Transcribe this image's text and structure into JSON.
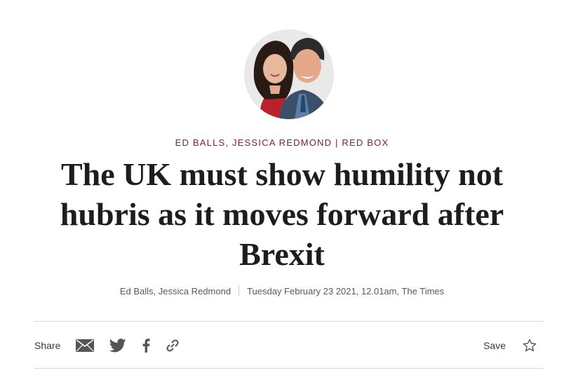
{
  "article": {
    "kicker": "ED BALLS, JESSICA REDMOND | RED BOX",
    "headline": "The UK must show humility not hubris as it moves forward after Brexit",
    "byline": {
      "authors": "Ed Balls, Jessica Redmond",
      "published": "Tuesday February 23 2021, 12.01am, The Times"
    }
  },
  "share_bar": {
    "share_label": "Share",
    "icons": [
      "email-icon",
      "twitter-icon",
      "facebook-icon",
      "link-icon"
    ],
    "save_label": "Save",
    "save_icon": "star-outline-icon"
  },
  "colors": {
    "kicker": "#8a1c30",
    "headline": "#1d1d1b",
    "meta": "#5a5a5a",
    "divider": "#d7d7d7"
  }
}
